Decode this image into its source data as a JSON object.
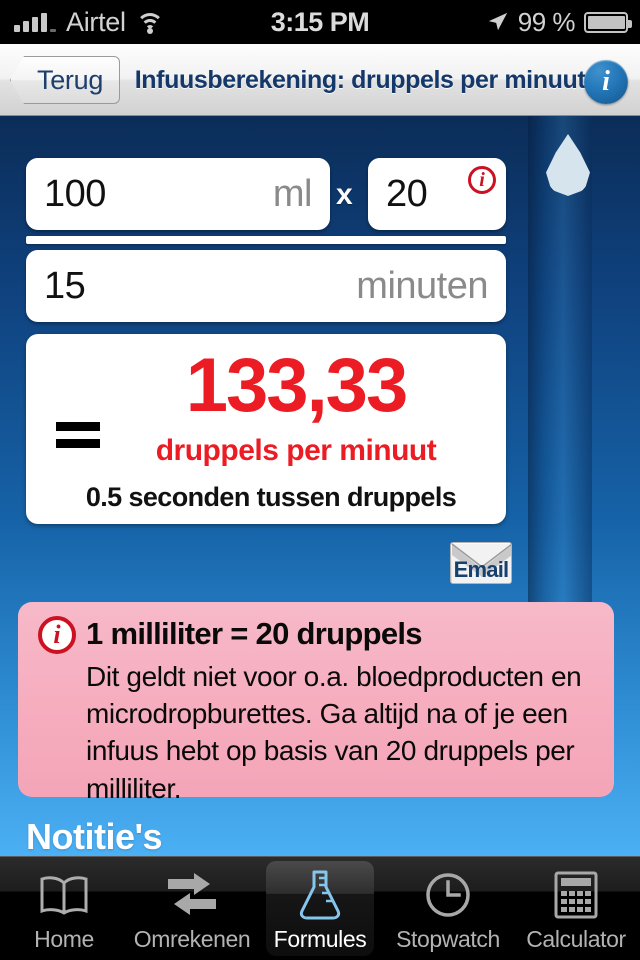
{
  "status_bar": {
    "carrier": "Airtel",
    "time": "3:15 PM",
    "battery_percent": "99 %",
    "signal_icon": "signal-bars-icon",
    "wifi_icon": "wifi-icon",
    "location_icon": "location-arrow-icon",
    "battery_icon": "battery-icon"
  },
  "nav_bar": {
    "back_label": "Terug",
    "title": "Infuusberekening: druppels per minuut",
    "info_glyph": "i"
  },
  "calculator": {
    "volume": {
      "value": "100",
      "unit": "ml"
    },
    "multiply_symbol": "x",
    "drop_factor": {
      "value": "20",
      "info_glyph": "i"
    },
    "time": {
      "value": "15",
      "unit": "minuten"
    },
    "equals_symbol": "=",
    "result": {
      "value": "133,33",
      "unit": "druppels per minuut",
      "secondary": "0.5 seconden tussen druppels"
    },
    "email_label": "Email"
  },
  "notice": {
    "icon_glyph": "i",
    "title": "1 milliliter = 20 druppels",
    "body": "Dit geldt niet voor o.a. bloedproducten en microdropburettes. Ga altijd na of je een infuus hebt op basis van 20 druppels per milliliter."
  },
  "notes_heading": "Notitie's",
  "tab_bar": {
    "items": [
      {
        "label": "Home",
        "icon": "book-icon",
        "active": false
      },
      {
        "label": "Omrekenen",
        "icon": "convert-arrows-icon",
        "active": false
      },
      {
        "label": "Formules",
        "icon": "flask-icon",
        "active": true
      },
      {
        "label": "Stopwatch",
        "icon": "clock-icon",
        "active": false
      },
      {
        "label": "Calculator",
        "icon": "calculator-icon",
        "active": false
      }
    ]
  },
  "colors": {
    "accent_red": "#ec1c24",
    "nav_title_blue": "#15386b",
    "notice_pink": "#f6aebf",
    "bg_top": "#0b2d58",
    "bg_bottom": "#4cb0f5"
  }
}
